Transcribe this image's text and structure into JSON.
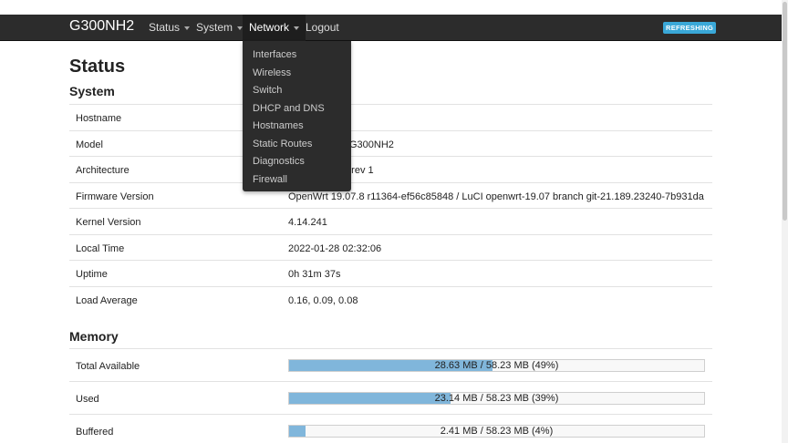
{
  "navbar": {
    "brand": "G300NH2",
    "menus": [
      {
        "label": "Status"
      },
      {
        "label": "System"
      },
      {
        "label": "Network"
      },
      {
        "label": "Logout"
      }
    ],
    "badge": "REFRESHING"
  },
  "network_dropdown": {
    "items": [
      "Interfaces",
      "Wireless",
      "Switch",
      "DHCP and DNS",
      "Hostnames",
      "Static Routes",
      "Diagnostics",
      "Firewall"
    ]
  },
  "page_title": "Status",
  "system": {
    "title": "System",
    "rows": [
      {
        "label": "Hostname",
        "value": ""
      },
      {
        "label": "Model",
        "value": "P-G300NH2"
      },
      {
        "label": "Architecture",
        "value": "2 rev 1"
      },
      {
        "label": "Firmware Version",
        "value": "OpenWrt 19.07.8 r11364-ef56c85848 / LuCI openwrt-19.07 branch git-21.189.23240-7b931da"
      },
      {
        "label": "Kernel Version",
        "value": "4.14.241"
      },
      {
        "label": "Local Time",
        "value": "2022-01-28 02:32:06"
      },
      {
        "label": "Uptime",
        "value": "0h 31m 37s"
      },
      {
        "label": "Load Average",
        "value": "0.16, 0.09, 0.08"
      }
    ]
  },
  "memory": {
    "title": "Memory",
    "rows": [
      {
        "label": "Total Available",
        "text": "28.63 MB / 58.23 MB (49%)",
        "percent": 49
      },
      {
        "label": "Used",
        "text": "23.14 MB / 58.23 MB (39%)",
        "percent": 39
      },
      {
        "label": "Buffered",
        "text": "2.41 MB / 58.23 MB (4%)",
        "percent": 4
      }
    ]
  },
  "colors": {
    "navbar_bg": "#2c2c2c",
    "badge_bg": "#3aa8d8",
    "progress_fill": "#80b6db"
  }
}
